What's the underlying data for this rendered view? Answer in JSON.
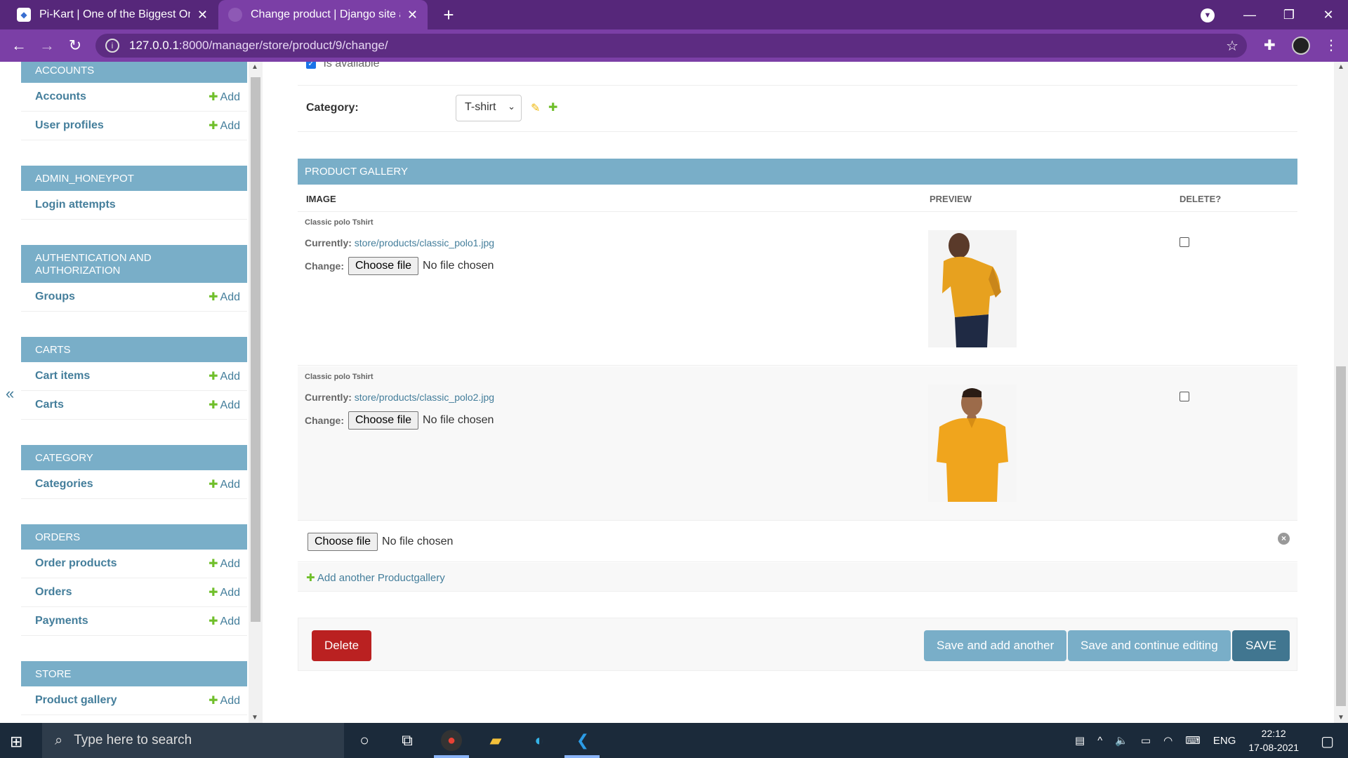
{
  "browser": {
    "tabs": [
      {
        "title": "Pi-Kart | One of the Biggest Online",
        "active": false
      },
      {
        "title": "Change product | Django site admin",
        "active": true
      }
    ],
    "url_host": "127.0.0.1",
    "url_path": ":8000/manager/store/product/9/change/"
  },
  "sidebar": {
    "modules": [
      {
        "caption": "ACCOUNTS",
        "rows": [
          {
            "label": "Accounts",
            "add": "Add"
          },
          {
            "label": "User profiles",
            "add": "Add"
          }
        ]
      },
      {
        "caption": "ADMIN_HONEYPOT",
        "rows": [
          {
            "label": "Login attempts",
            "add": ""
          }
        ]
      },
      {
        "caption": "AUTHENTICATION AND AUTHORIZATION",
        "rows": [
          {
            "label": "Groups",
            "add": "Add"
          }
        ]
      },
      {
        "caption": "CARTS",
        "rows": [
          {
            "label": "Cart items",
            "add": "Add"
          },
          {
            "label": "Carts",
            "add": "Add"
          }
        ]
      },
      {
        "caption": "CATEGORY",
        "rows": [
          {
            "label": "Categories",
            "add": "Add"
          }
        ]
      },
      {
        "caption": "ORDERS",
        "rows": [
          {
            "label": "Order products",
            "add": "Add"
          },
          {
            "label": "Orders",
            "add": "Add"
          },
          {
            "label": "Payments",
            "add": "Add"
          }
        ]
      },
      {
        "caption": "STORE",
        "rows": [
          {
            "label": "Product gallery",
            "add": "Add"
          }
        ]
      }
    ]
  },
  "form": {
    "is_available_label": "Is available",
    "category_label": "Category:",
    "category_value": "T-shirt"
  },
  "gallery": {
    "caption": "PRODUCT GALLERY",
    "columns": [
      "IMAGE",
      "PREVIEW",
      "DELETE?"
    ],
    "items": [
      {
        "name": "Classic polo Tshirt",
        "currently_label": "Currently:",
        "currently_value": "store/products/classic_polo1.jpg",
        "change_label": "Change:",
        "choose_file": "Choose file",
        "no_file": "No file chosen"
      },
      {
        "name": "Classic polo Tshirt",
        "currently_label": "Currently:",
        "currently_value": "store/products/classic_polo2.jpg",
        "change_label": "Change:",
        "choose_file": "Choose file",
        "no_file": "No file chosen"
      }
    ],
    "empty_row": {
      "choose_file": "Choose file",
      "no_file": "No file chosen"
    },
    "add_another": "Add another Productgallery"
  },
  "submit": {
    "delete": "Delete",
    "save_add_another": "Save and add another",
    "save_continue": "Save and continue editing",
    "save": "SAVE"
  },
  "taskbar": {
    "search_placeholder": "Type here to search",
    "lang": "ENG",
    "time": "22:12",
    "date": "17-08-2021"
  },
  "colors": {
    "header_blue": "#79aec8",
    "link_blue": "#447e9b",
    "add_green": "#70bf2b",
    "delete_red": "#ba2121",
    "save_dark": "#417690"
  }
}
